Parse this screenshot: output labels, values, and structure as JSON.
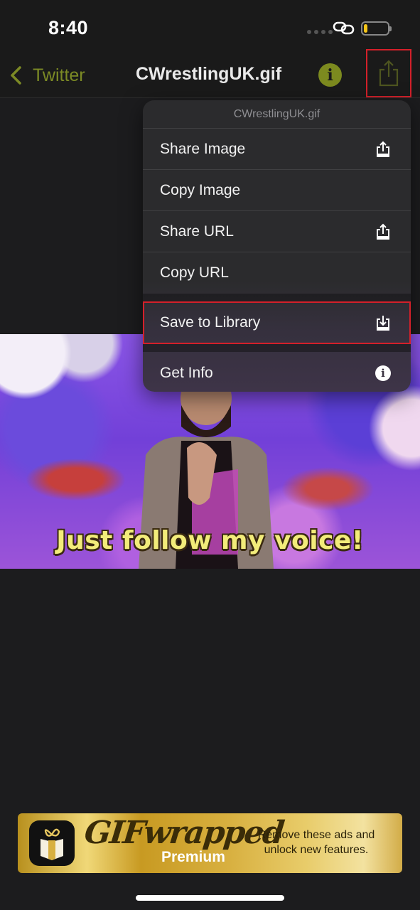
{
  "status_bar": {
    "time": "8:40",
    "battery_level": 0.15,
    "battery_color": "#f5c518"
  },
  "nav": {
    "back_label": "Twitter",
    "back_icon": "chevron-left-icon",
    "title": "CWrestlingUK.gif",
    "info_icon": "info-icon",
    "info_glyph": "i",
    "share_icon": "share-icon",
    "accent_color": "#7c8a25"
  },
  "menu": {
    "header": "CWrestlingUK.gif",
    "items": [
      {
        "label": "Share Image",
        "icon": "share-icon"
      },
      {
        "label": "Copy Image",
        "icon": ""
      },
      {
        "label": "Share URL",
        "icon": "share-icon"
      },
      {
        "label": "Copy URL",
        "icon": ""
      },
      {
        "label": "Save to Library",
        "icon": "download-icon",
        "highlighted": true
      },
      {
        "label": "Get Info",
        "icon": "info-icon",
        "glyph": "i"
      }
    ]
  },
  "gif": {
    "caption": "Just follow my voice!"
  },
  "ad": {
    "logo_text": "GIFwrapped",
    "premium_label": "Premium",
    "message": "Remove these ads and unlock new features."
  },
  "highlight_color": "#d4202a"
}
